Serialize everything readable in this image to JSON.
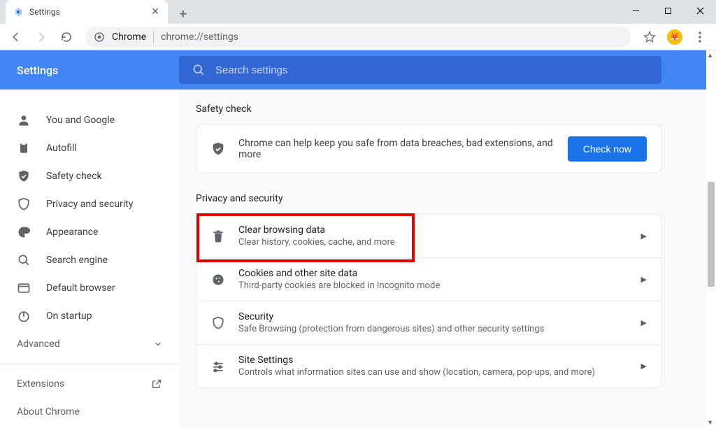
{
  "tab": {
    "title": "Settings"
  },
  "omnibox": {
    "origin": "Chrome",
    "url": "chrome://settings"
  },
  "header": {
    "title": "Settings"
  },
  "search": {
    "placeholder": "Search settings"
  },
  "sidebar": {
    "items": [
      {
        "label": "You and Google"
      },
      {
        "label": "Autofill"
      },
      {
        "label": "Safety check"
      },
      {
        "label": "Privacy and security"
      },
      {
        "label": "Appearance"
      },
      {
        "label": "Search engine"
      },
      {
        "label": "Default browser"
      },
      {
        "label": "On startup"
      }
    ],
    "advanced": "Advanced",
    "extensions": "Extensions",
    "about": "About Chrome"
  },
  "safety": {
    "heading": "Safety check",
    "text": "Chrome can help keep you safe from data breaches, bad extensions, and more",
    "button": "Check now"
  },
  "privacy": {
    "heading": "Privacy and security",
    "rows": [
      {
        "title": "Clear browsing data",
        "sub": "Clear history, cookies, cache, and more"
      },
      {
        "title": "Cookies and other site data",
        "sub": "Third-party cookies are blocked in Incognito mode"
      },
      {
        "title": "Security",
        "sub": "Safe Browsing (protection from dangerous sites) and other security settings"
      },
      {
        "title": "Site Settings",
        "sub": "Controls what information sites can use and show (location, camera, pop-ups, and more)"
      }
    ]
  }
}
